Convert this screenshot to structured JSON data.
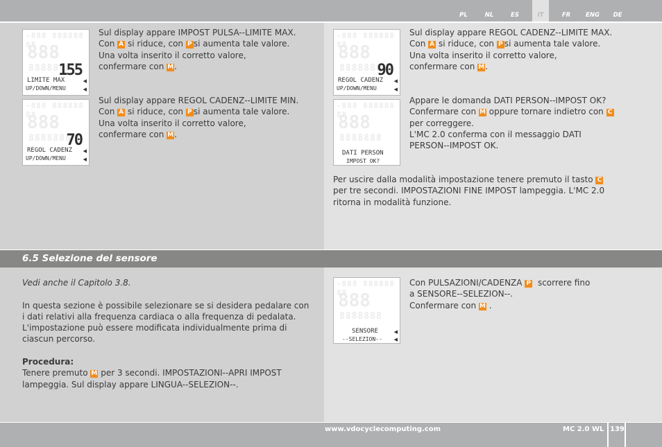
{
  "languages": [
    {
      "code": "PL",
      "active": false
    },
    {
      "code": "NL",
      "active": false
    },
    {
      "code": "ES",
      "active": false
    },
    {
      "code": "IT",
      "active": true
    },
    {
      "code": "FR",
      "active": false
    },
    {
      "code": "ENG",
      "active": false
    },
    {
      "code": "DE",
      "active": false
    }
  ],
  "keys": {
    "A": "A",
    "P": "P",
    "M": "M",
    "C": "C"
  },
  "lcd_ghost": {
    "row1": "-888 888888 88",
    "row2": "888",
    "row3": "8888888"
  },
  "top": {
    "left": [
      {
        "display": {
          "value": "155",
          "line1": "LIMITE MAX",
          "line2": "UP/DOWN/MENU"
        },
        "l1": "Sul display appare IMPOST PULSA--LIMITE MAX.",
        "l2a": "Con",
        "l2b": "si riduce, con",
        "l2c": "si aumenta tale valore.",
        "l3": "Una volta inserito il corretto valore,",
        "l4a": "confermare con",
        "l4b": "."
      },
      {
        "display": {
          "value": "70",
          "line1": "REGOL CADENZ",
          "line2": "UP/DOWN/MENU"
        },
        "l1": "Sul display appare REGOL CADENZ--LIMITE MIN.",
        "l2a": "Con",
        "l2b": "si riduce, con",
        "l2c": "si aumenta tale valore.",
        "l3": "Una volta inserito il corretto valore,",
        "l4a": "confermare con",
        "l4b": "."
      }
    ],
    "right": [
      {
        "display": {
          "value": "90",
          "line1": "REGOL CADENZ",
          "line2": "UP/DOWN/MENU"
        },
        "l1": "Sul display appare REGOL CADENZ--LIMITE MAX.",
        "l2a": "Con",
        "l2b": "si riduce, con",
        "l2c": "si aumenta tale valore.",
        "l3": "Una volta inserito il corretto valore,",
        "l4a": "confermare con",
        "l4b": "."
      },
      {
        "display": {
          "value": "",
          "line1": "DATI PERSON",
          "line2": "IMPOST OK?"
        },
        "l1": "Appare le domanda DATI PERSON--IMPOST OK?",
        "l2a": "Confermare con",
        "l2b": "oppure tornare indietro con",
        "l3": "per correggere.",
        "l4": "L'MC 2.0 conferma con il messaggio DATI",
        "l5": "PERSON--IMPOST OK."
      }
    ],
    "exit": {
      "l1a": "Per uscire dalla modalità impostazione tenere premuto il tasto",
      "l2": "per tre secondi. IMPOSTAZIONI FINE IMPOST lampeggia. L'MC 2.0",
      "l3": "ritorna in modalità funzione."
    }
  },
  "section": {
    "title": "6.5 Selezione del sensore"
  },
  "bottom": {
    "left": {
      "see_also": "Vedi anche il Capitolo 3.8.",
      "p1": "In questa sezione è possibile selezionare se si desidera pedalare con",
      "p2": "i dati relativi alla frequenza cardiaca o alla frequenza di pedalata.",
      "p3": "L'impostazione può essere modificata individualmente prima di",
      "p4": "ciascun percorso.",
      "proc_title": "Procedura:",
      "proc1a": "Tenere premuto",
      "proc1b": "per 3 secondi. IMPOSTAZIONI--APRI IMPOST",
      "proc2": "lampeggia. Sul display appare LINGUA--SELEZION--."
    },
    "right": {
      "display": {
        "value": "",
        "line1": "SENSORE",
        "line2": "--SELEZION--"
      },
      "l1a": "Con PULSAZIONI/CADENZA",
      "l1b": "scorrere fino",
      "l2": "a SENSORE--SELEZION--.",
      "l3a": "Confermare con",
      "l3b": "."
    }
  },
  "footer": {
    "url": "www.vdocyclecomputing.com",
    "model": "MC 2.0 WL",
    "page": "139"
  }
}
